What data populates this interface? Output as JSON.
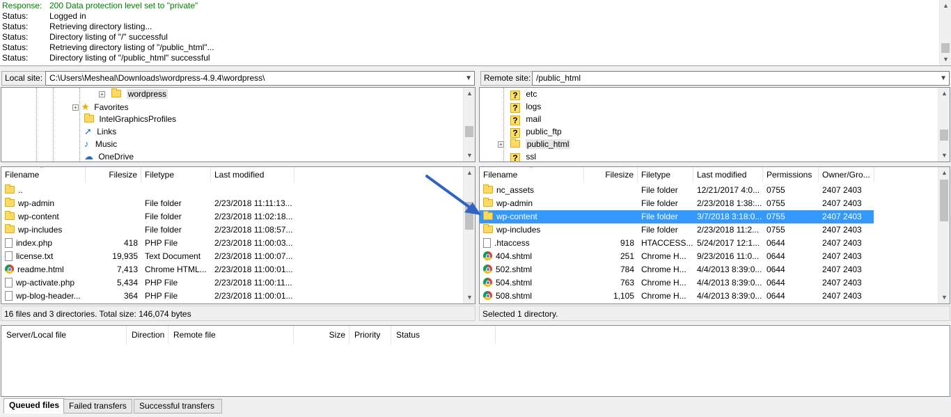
{
  "log": [
    {
      "key": "Response:",
      "value": "200 Data protection level set to \"private\"",
      "color": "#008000"
    },
    {
      "key": "Status:",
      "value": "Logged in"
    },
    {
      "key": "Status:",
      "value": "Retrieving directory listing..."
    },
    {
      "key": "Status:",
      "value": "Directory listing of \"/\" successful"
    },
    {
      "key": "Status:",
      "value": "Retrieving directory listing of \"/public_html\"..."
    },
    {
      "key": "Status:",
      "value": "Directory listing of \"/public_html\" successful"
    }
  ],
  "local": {
    "label": "Local site:",
    "path": "C:\\Users\\Mesheal\\Downloads\\wordpress-4.9.4\\wordpress\\",
    "tree": [
      "wordpress",
      "Favorites",
      "IntelGraphicsProfiles",
      "Links",
      "Music",
      "OneDrive"
    ],
    "columns": [
      "Filename",
      "Filesize",
      "Filetype",
      "Last modified"
    ],
    "files": [
      {
        "name": "..",
        "size": "",
        "type": "",
        "modified": "",
        "icon": "folder"
      },
      {
        "name": "wp-admin",
        "size": "",
        "type": "File folder",
        "modified": "2/23/2018 11:11:13...",
        "icon": "folder"
      },
      {
        "name": "wp-content",
        "size": "",
        "type": "File folder",
        "modified": "2/23/2018 11:02:18...",
        "icon": "folder"
      },
      {
        "name": "wp-includes",
        "size": "",
        "type": "File folder",
        "modified": "2/23/2018 11:08:57...",
        "icon": "folder"
      },
      {
        "name": "index.php",
        "size": "418",
        "type": "PHP File",
        "modified": "2/23/2018 11:00:03...",
        "icon": "file"
      },
      {
        "name": "license.txt",
        "size": "19,935",
        "type": "Text Document",
        "modified": "2/23/2018 11:00:07...",
        "icon": "file"
      },
      {
        "name": "readme.html",
        "size": "7,413",
        "type": "Chrome HTML...",
        "modified": "2/23/2018 11:00:01...",
        "icon": "chrome"
      },
      {
        "name": "wp-activate.php",
        "size": "5,434",
        "type": "PHP File",
        "modified": "2/23/2018 11:00:11...",
        "icon": "file"
      },
      {
        "name": "wp-blog-header...",
        "size": "364",
        "type": "PHP File",
        "modified": "2/23/2018 11:00:01...",
        "icon": "file"
      }
    ],
    "status": "16 files and 3 directories. Total size: 146,074 bytes"
  },
  "remote": {
    "label": "Remote site:",
    "path": "/public_html",
    "tree": [
      "etc",
      "logs",
      "mail",
      "public_ftp",
      "public_html",
      "ssl"
    ],
    "columns": [
      "Filename",
      "Filesize",
      "Filetype",
      "Last modified",
      "Permissions",
      "Owner/Gro..."
    ],
    "files": [
      {
        "name": "nc_assets",
        "size": "",
        "type": "File folder",
        "modified": "12/21/2017 4:0...",
        "perm": "0755",
        "owner": "2407 2403",
        "icon": "folder"
      },
      {
        "name": "wp-admin",
        "size": "",
        "type": "File folder",
        "modified": "2/23/2018 1:38:...",
        "perm": "0755",
        "owner": "2407 2403",
        "icon": "folder"
      },
      {
        "name": "wp-content",
        "size": "",
        "type": "File folder",
        "modified": "3/7/2018 3:18:0...",
        "perm": "0755",
        "owner": "2407 2403",
        "icon": "folder",
        "selected": true
      },
      {
        "name": "wp-includes",
        "size": "",
        "type": "File folder",
        "modified": "2/23/2018 11:2...",
        "perm": "0755",
        "owner": "2407 2403",
        "icon": "folder"
      },
      {
        "name": ".htaccess",
        "size": "918",
        "type": "HTACCESS...",
        "modified": "5/24/2017 12:1...",
        "perm": "0644",
        "owner": "2407 2403",
        "icon": "file"
      },
      {
        "name": "404.shtml",
        "size": "251",
        "type": "Chrome H...",
        "modified": "9/23/2016 11:0...",
        "perm": "0644",
        "owner": "2407 2403",
        "icon": "chrome"
      },
      {
        "name": "502.shtml",
        "size": "784",
        "type": "Chrome H...",
        "modified": "4/4/2013 8:39:0...",
        "perm": "0644",
        "owner": "2407 2403",
        "icon": "chrome"
      },
      {
        "name": "504.shtml",
        "size": "763",
        "type": "Chrome H...",
        "modified": "4/4/2013 8:39:0...",
        "perm": "0644",
        "owner": "2407 2403",
        "icon": "chrome"
      },
      {
        "name": "508.shtml",
        "size": "1,105",
        "type": "Chrome H...",
        "modified": "4/4/2013 8:39:0...",
        "perm": "0644",
        "owner": "2407 2403",
        "icon": "chrome"
      }
    ],
    "status": "Selected 1 directory."
  },
  "queue": {
    "columns": [
      "Server/Local file",
      "Direction",
      "Remote file",
      "Size",
      "Priority",
      "Status"
    ],
    "tabs": [
      "Queued files",
      "Failed transfers",
      "Successful transfers"
    ]
  },
  "colors": {
    "selection": "#3399ff",
    "arrow": "#2f63c6"
  }
}
